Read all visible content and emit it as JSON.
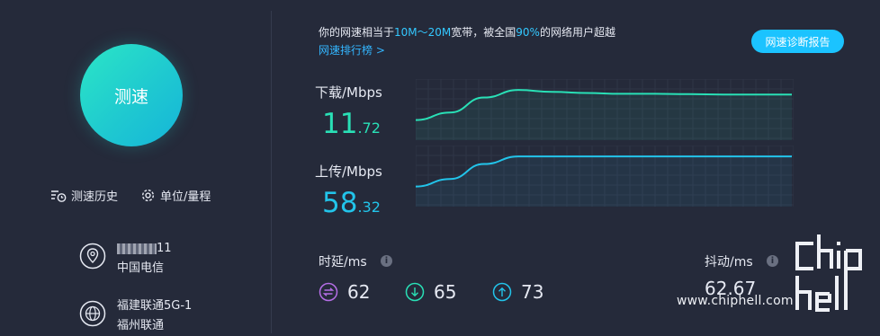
{
  "left": {
    "speed_test_button": "测速",
    "history_label": "测速历史",
    "units_label": "单位/量程",
    "network1": {
      "ip_suffix": "11",
      "isp": "中国电信"
    },
    "network2": {
      "name": "福建联通5G-1",
      "isp": "福州联通"
    }
  },
  "summary": {
    "prefix": "你的网速相当于",
    "range": "10M～20M",
    "middle": "宽带，被全国",
    "percent": "90%",
    "suffix": "的网络用户超越",
    "ranking_link": "网速排行榜 >",
    "diagnose_button": "网速诊断报告"
  },
  "download": {
    "label": "下载/Mbps",
    "int": "11",
    "dec": ".72"
  },
  "upload": {
    "label": "上传/Mbps",
    "int": "58",
    "dec": ".32"
  },
  "latency": {
    "label": "时延/ms",
    "items": [
      "62",
      "65",
      "73"
    ]
  },
  "jitter": {
    "label": "抖动/ms",
    "value": "62.67"
  },
  "watermark": {
    "url": "www.chiphell.com"
  },
  "colors": {
    "accent": "#1bc3ff",
    "download": "#29e0b6",
    "upload": "#22c4ea",
    "background": "#252a3a"
  },
  "chart_data": [
    {
      "type": "area",
      "series": [
        {
          "values": [
            2,
            4,
            8,
            10,
            9.5,
            9.2,
            9,
            9,
            8.9,
            8.8,
            8.8,
            8.8
          ]
        }
      ]
    },
    {
      "type": "area",
      "series": [
        {
          "values": [
            2,
            4,
            8,
            10,
            10,
            10,
            10,
            10,
            10,
            10,
            10,
            10
          ]
        }
      ]
    }
  ]
}
